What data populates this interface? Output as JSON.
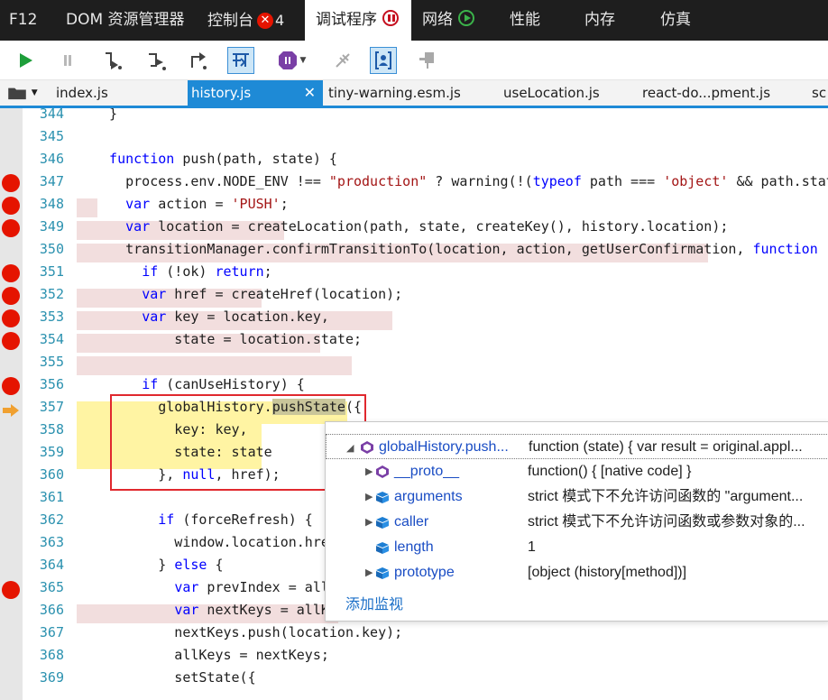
{
  "topbar": {
    "tabs": [
      {
        "label": "F12"
      },
      {
        "label": "DOM 资源管理器"
      },
      {
        "label": "控制台",
        "badge": "✕",
        "count": "4"
      },
      {
        "label": "调试程序",
        "active": true
      },
      {
        "label": "网络"
      },
      {
        "label": "性能"
      },
      {
        "label": "内存"
      },
      {
        "label": "仿真"
      }
    ]
  },
  "toolbar": {
    "icons": [
      "continue-icon",
      "break-all-icon",
      "step-into-icon",
      "step-over-icon",
      "step-out-icon",
      "break-on-new-worker-icon",
      "exceptions-icon",
      "disconnect-icon",
      "just-my-code-icon",
      "pin-icon"
    ]
  },
  "filetabs": [
    {
      "label": "index.js"
    },
    {
      "label": "history.js",
      "active": true,
      "close": "✕"
    },
    {
      "label": "tiny-warning.esm.js"
    },
    {
      "label": "useLocation.js"
    },
    {
      "label": "react-do...pment.js"
    },
    {
      "label": "sc"
    }
  ],
  "colors": {
    "breakpoint": "#e51400",
    "accent": "#1e8ad6",
    "current_line": "#fff4a3",
    "keyword": "#0000ff",
    "string": "#a31515"
  },
  "code": [
    {
      "n": "344",
      "t": "  }"
    },
    {
      "n": "345",
      "t": ""
    },
    {
      "n": "346",
      "t": "  function push(path, state) {"
    },
    {
      "n": "347",
      "t": "    process.env.NODE_ENV !== \"production\" ? warning(!(typeof path === 'object' && path.stat"
    },
    {
      "n": "348",
      "t": "    var action = 'PUSH';"
    },
    {
      "n": "349",
      "t": "    var location = createLocation(path, state, createKey(), history.location);"
    },
    {
      "n": "350",
      "t": "    transitionManager.confirmTransitionTo(location, action, getUserConfirmation, function ("
    },
    {
      "n": "351",
      "t": "      if (!ok) return;"
    },
    {
      "n": "352",
      "t": "      var href = createHref(location);"
    },
    {
      "n": "353",
      "t": "      var key = location.key,"
    },
    {
      "n": "354",
      "t": "          state = location.state;"
    },
    {
      "n": "355",
      "t": ""
    },
    {
      "n": "356",
      "t": "      if (canUseHistory) {"
    },
    {
      "n": "357",
      "t": "        globalHistory.pushState({"
    },
    {
      "n": "358",
      "t": "          key: key,"
    },
    {
      "n": "359",
      "t": "          state: state"
    },
    {
      "n": "360",
      "t": "        }, null, href);"
    },
    {
      "n": "361",
      "t": ""
    },
    {
      "n": "362",
      "t": "        if (forceRefresh) {"
    },
    {
      "n": "363",
      "t": "          window.location.href"
    },
    {
      "n": "364",
      "t": "        } else {"
    },
    {
      "n": "365",
      "t": "          var prevIndex = allK"
    },
    {
      "n": "366",
      "t": "          var nextKeys = allKe"
    },
    {
      "n": "367",
      "t": "          nextKeys.push(location.key);"
    },
    {
      "n": "368",
      "t": "          allKeys = nextKeys;"
    },
    {
      "n": "369",
      "t": "          setState({"
    }
  ],
  "datatip": {
    "rows": [
      {
        "name": "globalHistory.push...",
        "value": "function (state) { var result = original.appl..."
      },
      {
        "name": "__proto__",
        "value": "function() { [native code] }"
      },
      {
        "name": "arguments",
        "value": "strict 模式下不允许访问函数的 \"argument..."
      },
      {
        "name": "caller",
        "value": "strict 模式下不允许访问函数或参数对象的..."
      },
      {
        "name": "length",
        "value": "1"
      },
      {
        "name": "prototype",
        "value": "[object (history[method])]"
      }
    ],
    "add_watch": "添加监视"
  }
}
